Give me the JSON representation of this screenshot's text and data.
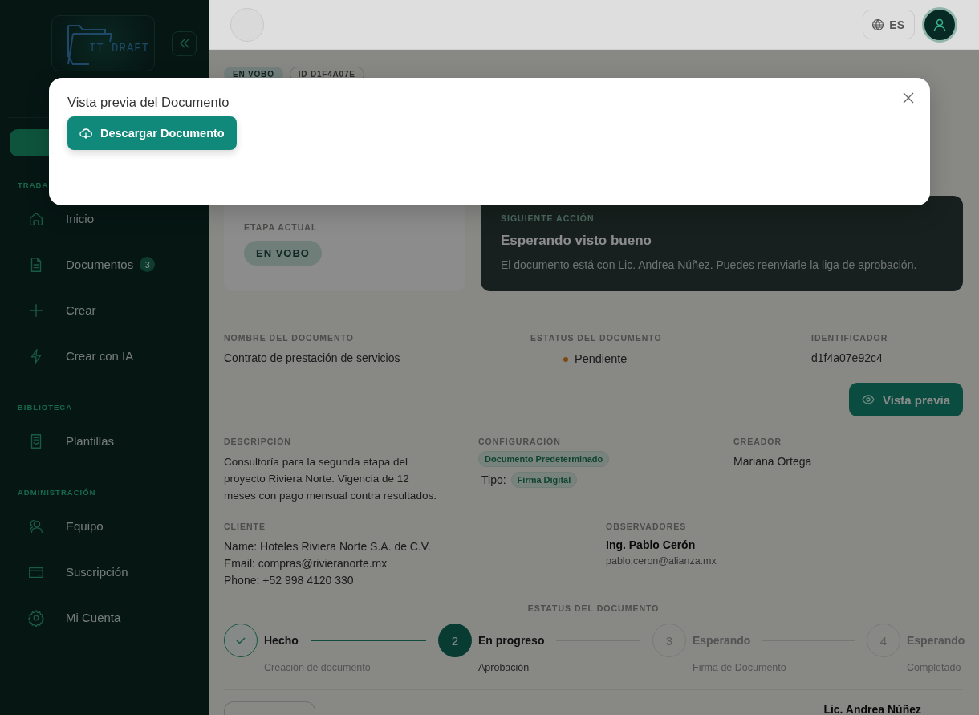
{
  "sidebar": {
    "logo": {
      "text": "IT DRAFT"
    },
    "sections": [
      {
        "label": "TRABA",
        "items": [
          {
            "label": "Inicio"
          },
          {
            "label": "Documentos",
            "badge": "3"
          },
          {
            "label": "Crear"
          },
          {
            "label": "Crear con IA"
          }
        ]
      },
      {
        "label": "BIBLIOTECA",
        "items": [
          {
            "label": "Plantillas"
          }
        ]
      },
      {
        "label": "ADMINISTRACIÓN",
        "items": [
          {
            "label": "Equipo"
          },
          {
            "label": "Suscripción"
          },
          {
            "label": "Mi Cuenta"
          }
        ]
      }
    ]
  },
  "header": {
    "language": "ES"
  },
  "document": {
    "badges": [
      {
        "text": "EN VOBO",
        "kind": "status"
      },
      {
        "text": "ID D1F4A07E",
        "kind": "outline"
      }
    ],
    "current_stage": {
      "label": "ETAPA ACTUAL",
      "value": "EN VOBO"
    },
    "next_action": {
      "label": "SIGUIENTE ACCIÓN",
      "title": "Esperando visto bueno",
      "text": "El documento está con Lic. Andrea Núñez. Puedes reenviarle la liga de aprobación."
    },
    "name": {
      "label": "NOMBRE DEL DOCUMENTO",
      "value": "Contrato de prestación de servicios"
    },
    "status": {
      "label": "ESTATUS DEL DOCUMENTO",
      "value": "Pendiente"
    },
    "identifier": {
      "label": "IDENTIFICADOR",
      "value": "d1f4a07e92c4"
    },
    "preview_button": "Vista previa",
    "description": {
      "label": "DESCRIPCIÓN",
      "value": "Consultoría para la segunda etapa del proyecto Riviera Norte. Vigencia de 12 meses con pago mensual contra resultados."
    },
    "configuration": {
      "label": "CONFIGURACIÓN",
      "tag": "Documento Predeterminado",
      "type_label": "Tipo:",
      "type_tag": "Firma Digital"
    },
    "creator": {
      "label": "CREADOR",
      "value": "Mariana Ortega"
    },
    "client": {
      "label": "CLIENTE",
      "lines": [
        "Name: Hoteles Riviera Norte S.A. de C.V.",
        "Email: compras@rivieranorte.mx",
        "Phone: +52 998 4120 330"
      ]
    },
    "observers": {
      "label": "OBSERVADORES",
      "name": "Ing. Pablo Cerón",
      "email": "pablo.ceron@alianza.mx"
    },
    "progress": {
      "label": "ESTATUS DEL DOCUMENTO",
      "steps": [
        {
          "completed": true,
          "active": false,
          "title": "Hecho",
          "subtitle": "Creación de documento"
        },
        {
          "completed": false,
          "active": true,
          "number": "2",
          "title": "En progreso",
          "subtitle": "Aprobación"
        },
        {
          "completed": false,
          "active": false,
          "number": "3",
          "title": "Esperando",
          "subtitle": "Firma de Documento"
        },
        {
          "completed": false,
          "active": false,
          "number": "4",
          "title": "Esperando",
          "subtitle": "Completado"
        }
      ]
    },
    "signer": "Lic. Andrea Núñez"
  },
  "modal": {
    "title": "Vista previa del Documento",
    "download_button": "Descargar Documento"
  }
}
